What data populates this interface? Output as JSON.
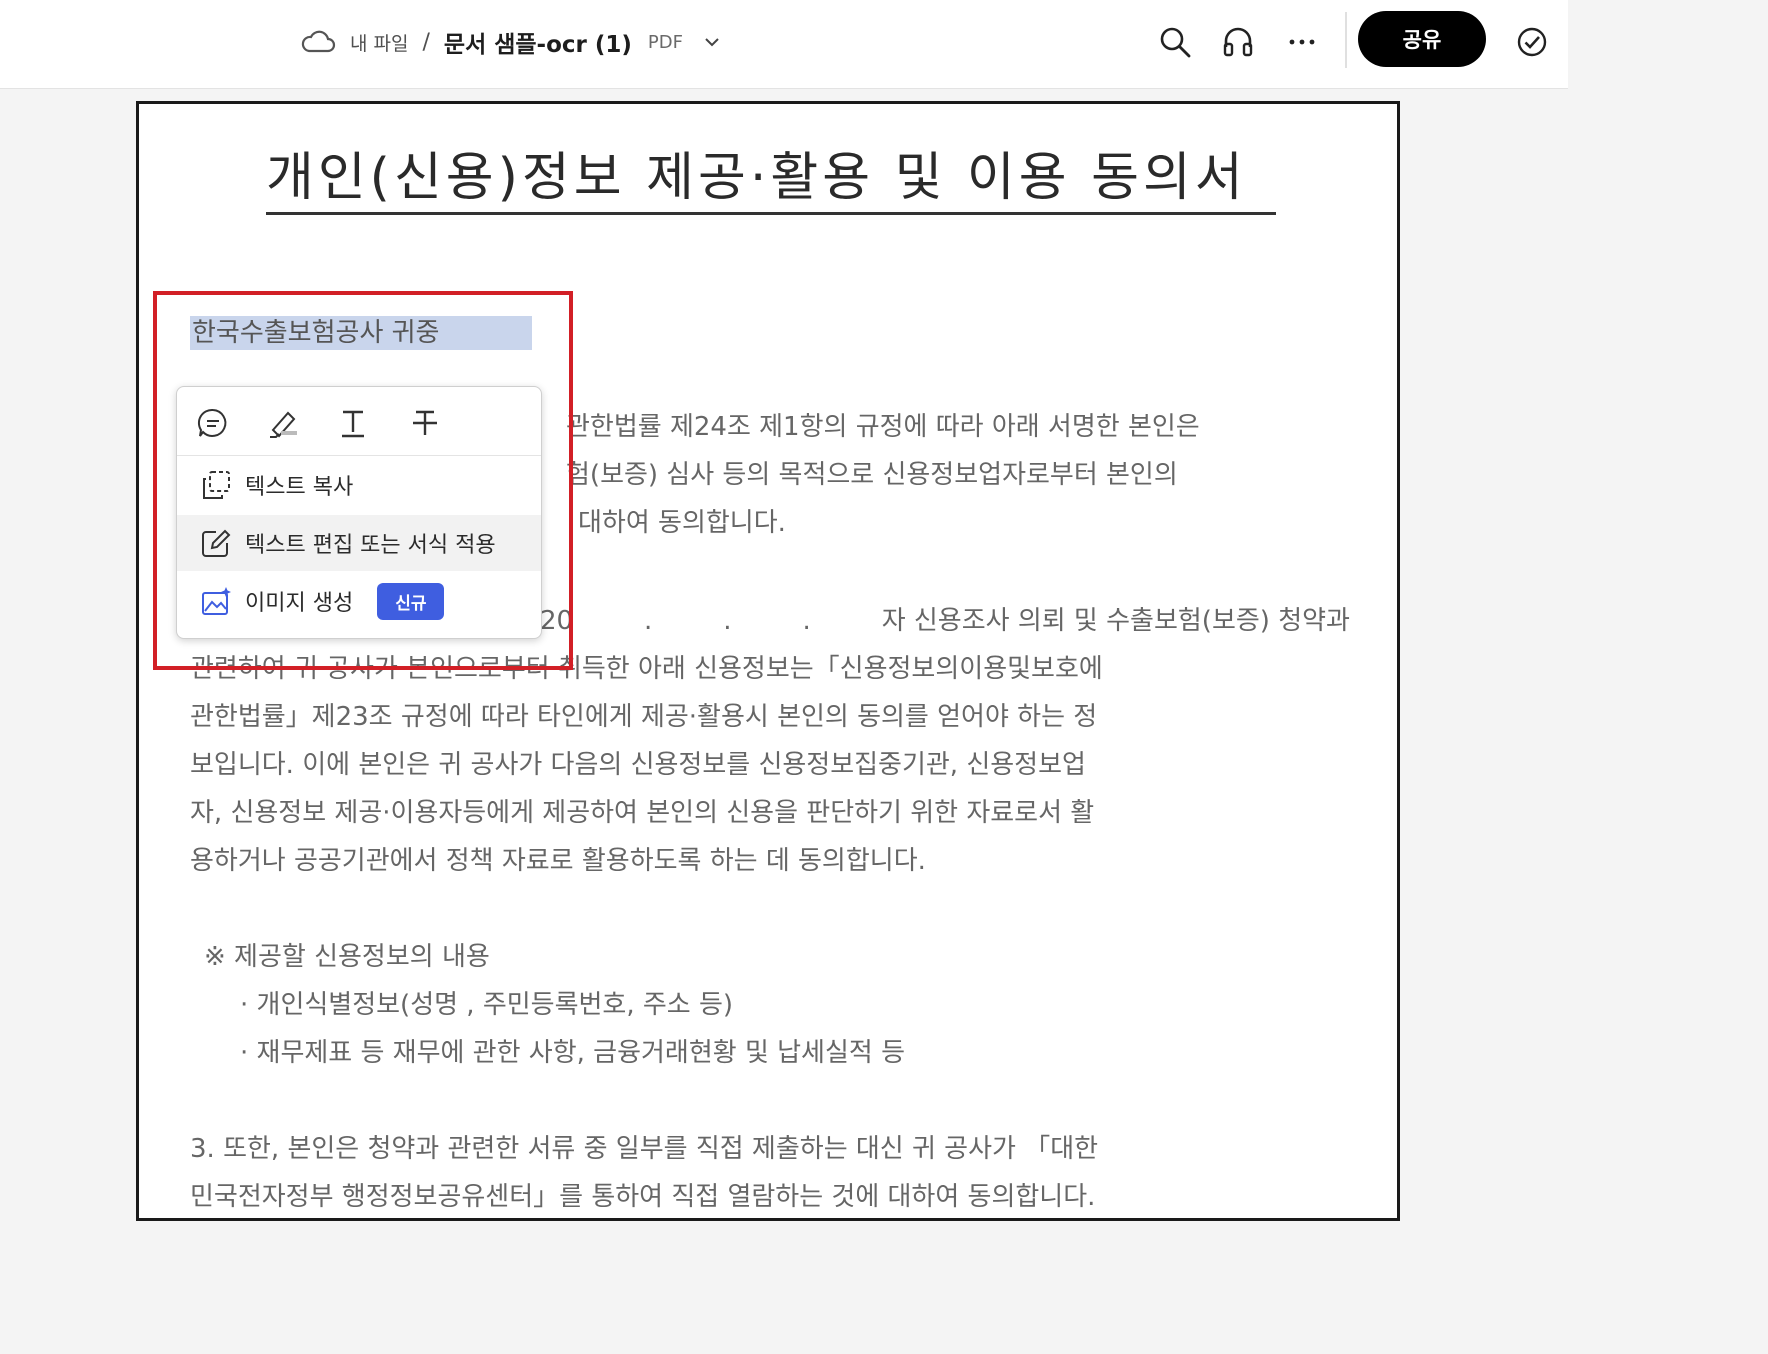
{
  "header": {
    "root": "내 파일",
    "separator": "/",
    "file_name": "문서 샘플-ocr (1)",
    "file_type": "PDF",
    "share_label": "공유"
  },
  "document": {
    "title": "개인(신용)정보 제공·활용 및 이용 동의서",
    "addressee": "한국수출보험공사 귀중",
    "p1": [
      "관한법률 제24조 제1항의 규정에 따라 아래 서명한 본인은",
      "험(보증) 심사 등의 목적으로 신용정보업자로부터 본인의",
      "대하여 동의합니다."
    ],
    "p2_first": [
      "20",
      ".",
      ".",
      ".",
      "자 신용조사 의뢰 및 수출보험(보증) 청약과"
    ],
    "p2": [
      "관련하여 귀 공사가 본인으로부터 취득한 아래 신용정보는「신용정보의이용및보호에",
      "관한법률」제23조 규정에 따라 타인에게 제공·활용시 본인의 동의를 얻어야 하는 정",
      "보입니다. 이에 본인은 귀 공사가 다음의 신용정보를 신용정보집중기관, 신용정보업",
      "자, 신용정보 제공·이용자등에게 제공하여 본인의 신용을 판단하기 위한 자료로서 활",
      "용하거나 공공기관에서 정책 자료로 활용하도록 하는 데 동의합니다."
    ],
    "section_heading": "※ 제공할 신용정보의 내용",
    "bullets": [
      "· 개인식별정보(성명 , 주민등록번호, 주소 등)",
      "· 재무제표 등 재무에 관한 사항, 금융거래현황 및 납세실적 등"
    ],
    "p3": [
      "3. 또한, 본인은 청약과 관련한 서류 중 일부를 직접 제출하는 대신 귀 공사가 「대한",
      "민국전자정부 행정정보공유센터」를 통하여 직접 열람하는 것에 대하여 동의합니다."
    ]
  },
  "popup": {
    "copy_text": "텍스트 복사",
    "edit_text": "텍스트 편집 또는 서식 적용",
    "generate_image": "이미지 생성",
    "new_badge": "신규"
  }
}
